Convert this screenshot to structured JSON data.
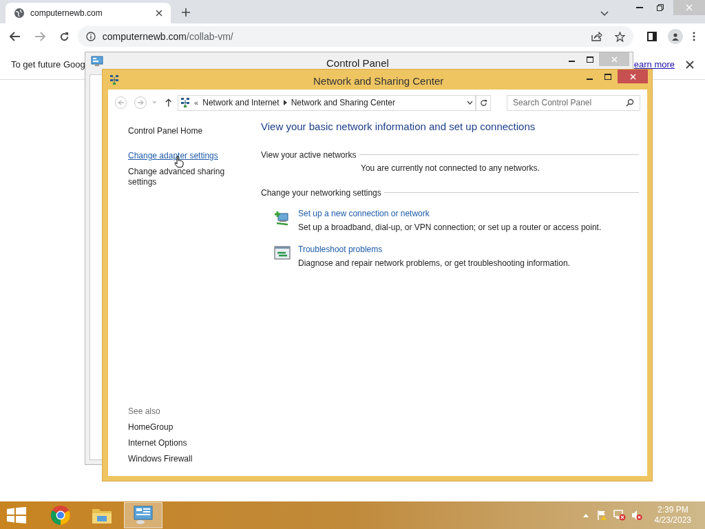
{
  "browser": {
    "tab_title": "computernewb.com",
    "url_host": "computernewb.com",
    "url_path": "/collab-vm/",
    "infobar_text": "To get future Goog",
    "infobar_link": "earn more"
  },
  "back_window": {
    "title": "Control Panel"
  },
  "window": {
    "title": "Network and Sharing Center",
    "breadcrumb_overflow": "«",
    "breadcrumbs": [
      "Network and Internet",
      "Network and Sharing Center"
    ],
    "search": {
      "placeholder": "Search Control Panel"
    },
    "sidebar": {
      "items": [
        {
          "label": "Control Panel Home",
          "hovered": false
        },
        {
          "label": "Change adapter settings",
          "hovered": true
        },
        {
          "label": "Change advanced sharing settings",
          "hovered": false
        }
      ],
      "see_also_title": "See also",
      "see_also": [
        "HomeGroup",
        "Internet Options",
        "Windows Firewall"
      ]
    },
    "heading": "View your basic network information and set up connections",
    "active_networks": {
      "title": "View your active networks",
      "message": "You are currently not connected to any networks."
    },
    "settings": {
      "title": "Change your networking settings",
      "tasks": [
        {
          "kind": "new-connection",
          "title": "Set up a new connection or network",
          "description": "Set up a broadband, dial-up, or VPN connection; or set up a router or access point."
        },
        {
          "kind": "troubleshoot",
          "title": "Troubleshoot problems",
          "description": "Diagnose and repair network problems, or get troubleshooting information."
        }
      ]
    }
  },
  "taskbar": {
    "apps": [
      {
        "kind": "chrome",
        "selected": false
      },
      {
        "kind": "explorer",
        "selected": false
      },
      {
        "kind": "control-panel",
        "selected": true
      }
    ],
    "time": "2:39 PM",
    "date": "4/23/2023"
  }
}
